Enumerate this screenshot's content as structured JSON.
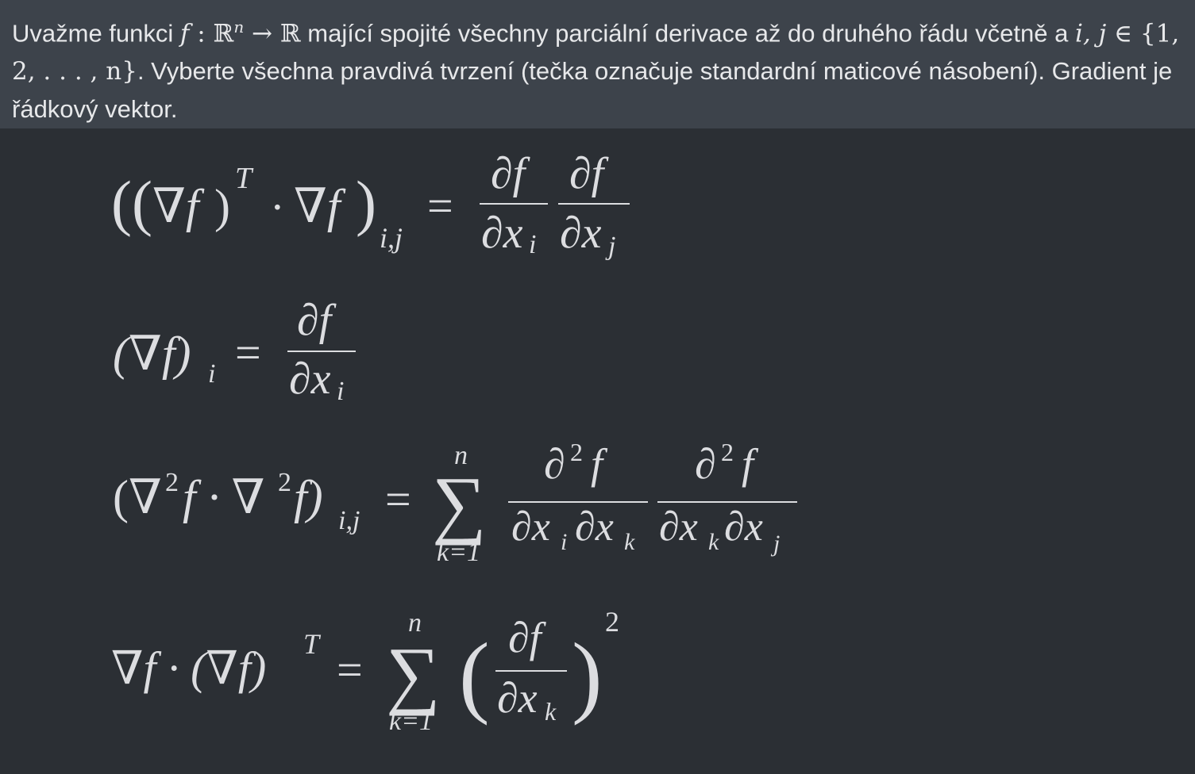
{
  "question": {
    "p1": "Uvažme funkci ",
    "m_f": "f",
    "m_colon": " : ",
    "m_Rn": "ℝ",
    "m_n": "n",
    "m_arrow": " → ",
    "m_R": "ℝ",
    "p2": " mající spojité všechny parciální derivace až do druhého řádu včetně a ",
    "m_ij": "i, j",
    "m_in": " ∈ ",
    "m_set": "{1, 2, . . . , n}",
    "p3": ". Vyberte všechna pravdivá tvrzení (tečka označuje standardní maticové násobení). Gradient je řádkový vektor."
  },
  "options": [
    {
      "lhs_open": "((",
      "nabla_f": "∇f",
      "paren_close": ")",
      "sup_T": "T",
      "dot": "·",
      "nabla_f2": "∇f",
      "lhs_close": ")",
      "sub_ij": "i,j",
      "eq": "=",
      "num1": "∂f",
      "den1": "∂x",
      "den1_sub": "i",
      "num2": "∂f",
      "den2": "∂x",
      "den2_sub": "j"
    },
    {
      "lhs": "(∇f)",
      "sub_i": "i",
      "eq": "=",
      "num": "∂f",
      "den": "∂x",
      "den_sub": "i"
    },
    {
      "lhs_a": "(∇",
      "sup2a": "2",
      "lhs_b": "f · ∇",
      "sup2b": "2",
      "lhs_c": "f)",
      "sub_ij": "i,j",
      "eq": "=",
      "sum": "∑",
      "sum_top": "n",
      "sum_bottom": "k=1",
      "num1": "∂",
      "num1_sup": "2",
      "num1_f": "f",
      "den1": "∂x",
      "den1_sub_i": "i",
      "den1_b": "∂x",
      "den1_sub_k": "k",
      "num2": "∂",
      "num2_sup": "2",
      "num2_f": "f",
      "den2": "∂x",
      "den2_sub_k": "k",
      "den2_b": "∂x",
      "den2_sub_j": "j"
    },
    {
      "lhs_a": "∇f · (∇f)",
      "sup_T": "T",
      "eq": "=",
      "sum": "∑",
      "sum_top": "n",
      "sum_bottom": "k=1",
      "open": "(",
      "num": "∂f",
      "den": "∂x",
      "den_sub": "k",
      "close": ")",
      "sup2": "2"
    }
  ]
}
